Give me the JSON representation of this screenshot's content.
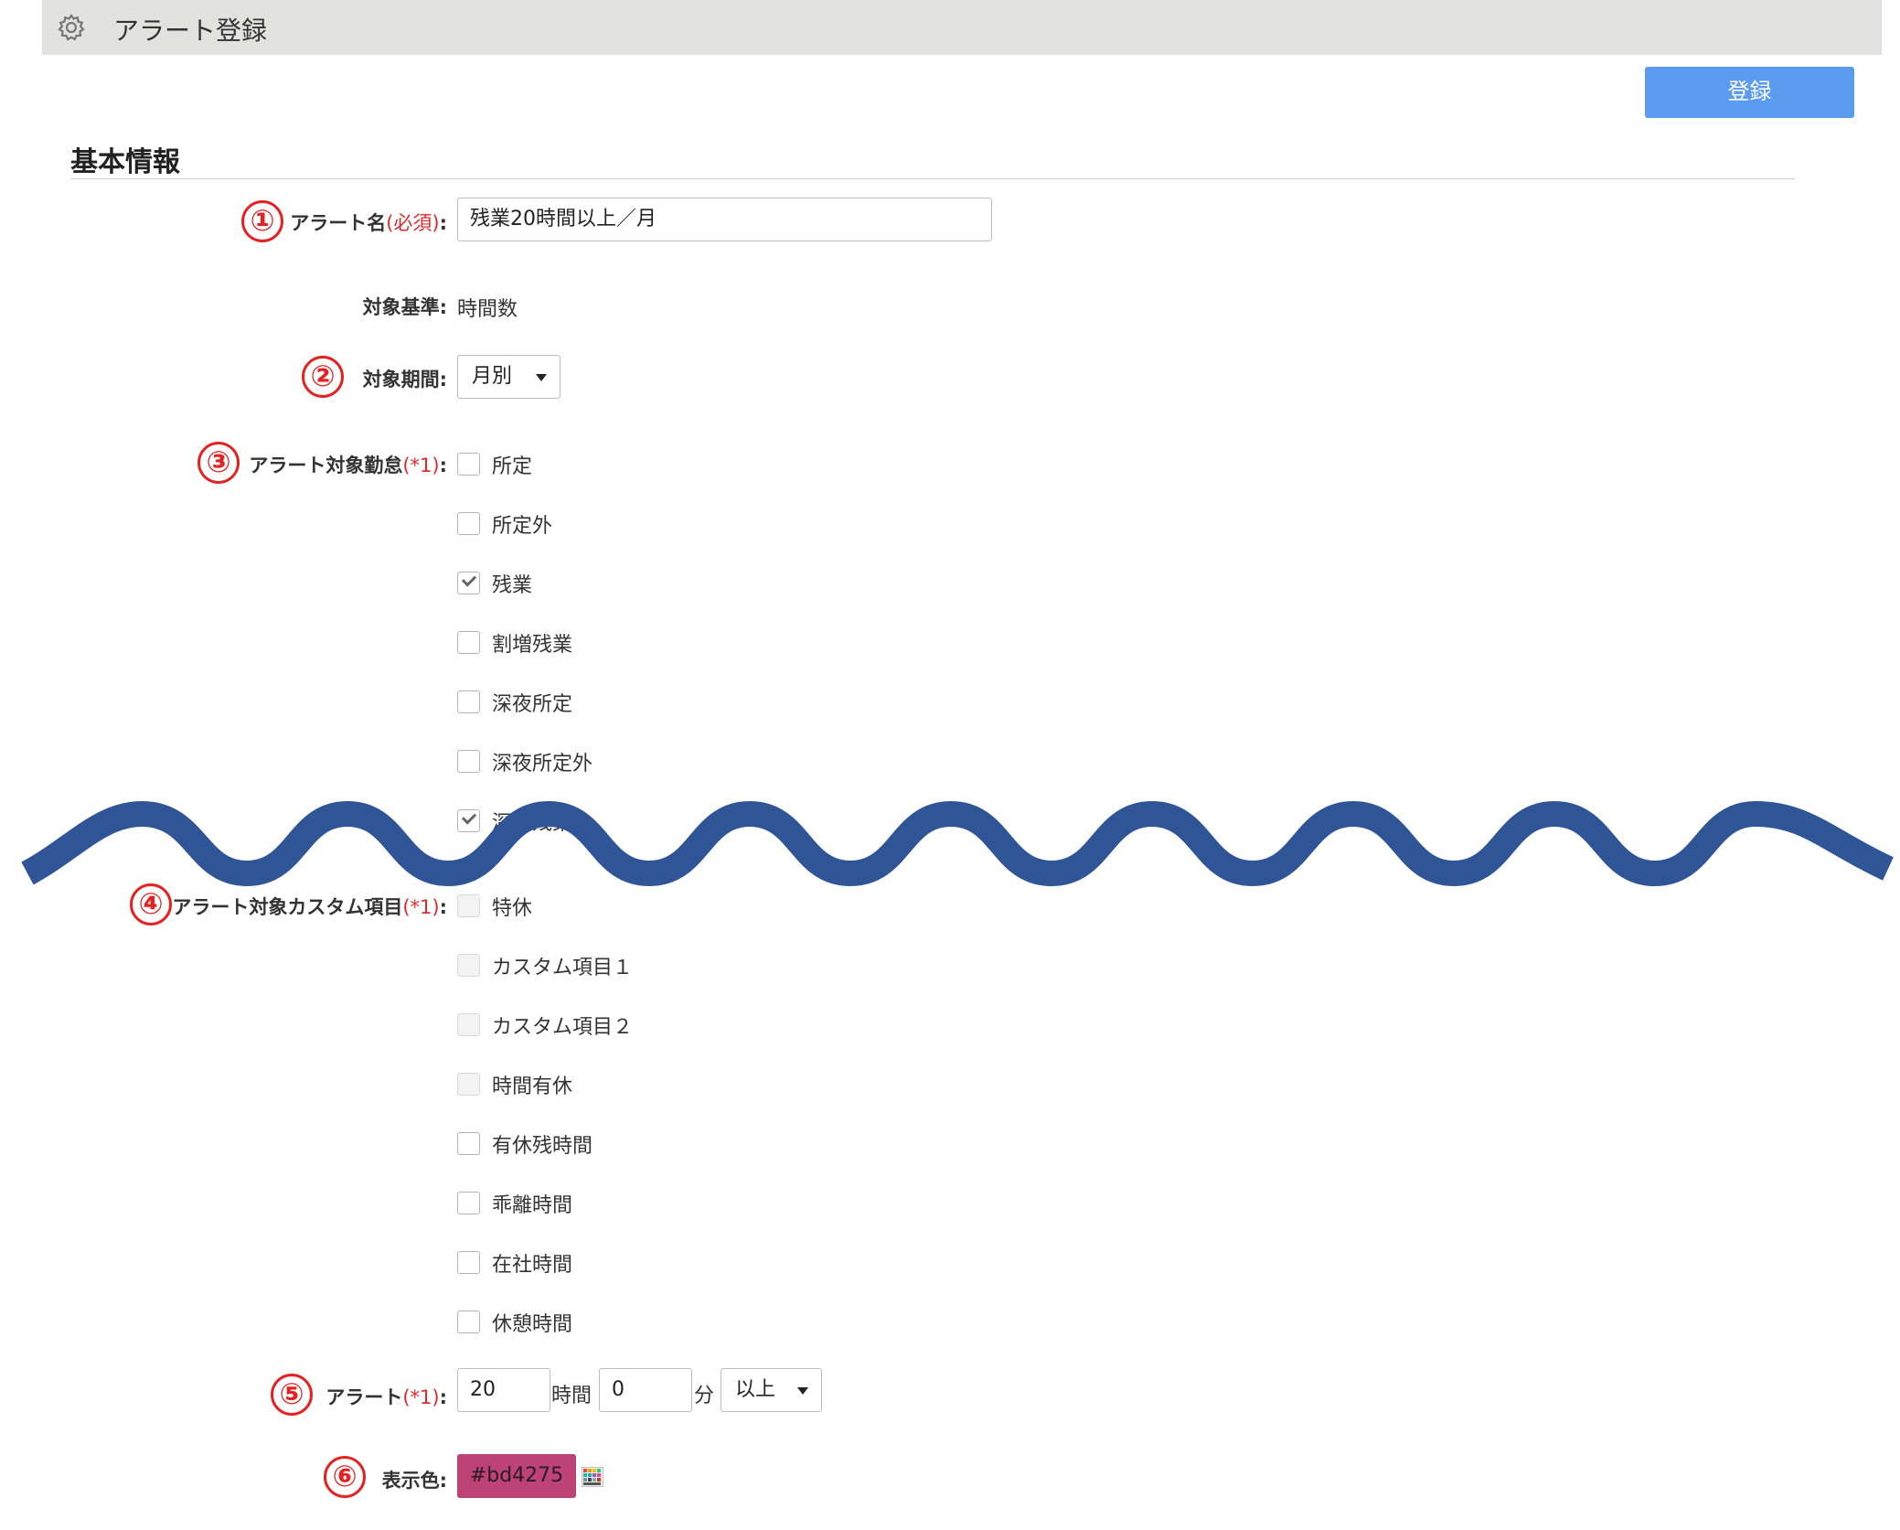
{
  "window": {
    "title": "アラート登録",
    "icon": "gear-icon"
  },
  "toolbar": {
    "register_label": "登録"
  },
  "section": {
    "title": "基本情報"
  },
  "form": {
    "alert_name": {
      "badge": "①",
      "label": "アラート名",
      "required": "(必須)",
      "colon": ":",
      "value": "残業20時間以上／月"
    },
    "target_basis": {
      "label": "対象基準:",
      "value": "時間数"
    },
    "target_period": {
      "badge": "②",
      "label": "対象期間:",
      "value": "月別"
    },
    "alert_attendance": {
      "badge": "③",
      "label": "アラート対象勤怠",
      "required": "(*1)",
      "colon": ":",
      "options": [
        {
          "label": "所定",
          "checked": false
        },
        {
          "label": "所定外",
          "checked": false
        },
        {
          "label": "残業",
          "checked": true
        },
        {
          "label": "割増残業",
          "checked": false
        },
        {
          "label": "深夜所定",
          "checked": false
        },
        {
          "label": "深夜所定外",
          "checked": false
        },
        {
          "label": "深夜残業",
          "checked": true
        }
      ]
    },
    "alert_custom": {
      "badge": "④",
      "label": "アラート対象カスタム項目",
      "required": "(*1)",
      "colon": ":",
      "options": [
        {
          "label": "特休",
          "checked": false,
          "disabled": true
        },
        {
          "label": "カスタム項目１",
          "checked": false,
          "disabled": true
        },
        {
          "label": "カスタム項目２",
          "checked": false,
          "disabled": true
        },
        {
          "label": "時間有休",
          "checked": false,
          "disabled": true
        },
        {
          "label": "有休残時間",
          "checked": false,
          "disabled": false
        },
        {
          "label": "乖離時間",
          "checked": false,
          "disabled": false
        },
        {
          "label": "在社時間",
          "checked": false,
          "disabled": false
        },
        {
          "label": "休憩時間",
          "checked": false,
          "disabled": false
        }
      ]
    },
    "alert_threshold": {
      "badge": "⑤",
      "label": "アラート",
      "required": "(*1)",
      "colon": ":",
      "hours": "20",
      "hours_unit": "時間",
      "minutes": "0",
      "minutes_unit": "分",
      "comparison": "以上"
    },
    "display_color": {
      "badge": "⑥",
      "label": "表示色:",
      "value": "#bd4275",
      "color": "#bd4275",
      "icon": "palette-icon"
    }
  },
  "colors": {
    "accent": "#5b9cf0",
    "annotation": "#e52222",
    "wave": "#2f5597",
    "required": "#e02a2a"
  }
}
